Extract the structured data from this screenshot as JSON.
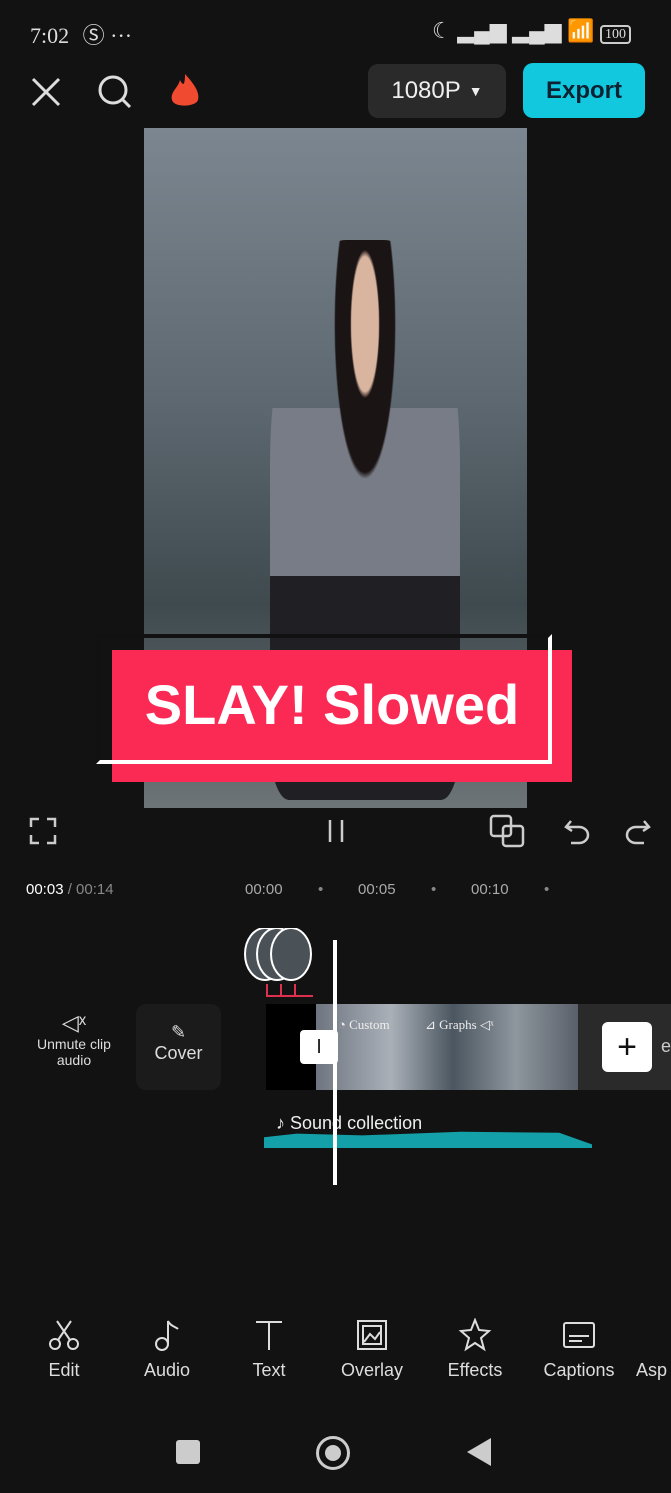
{
  "status": {
    "time": "7:02",
    "battery": "100"
  },
  "topbar": {
    "resolution": "1080P",
    "export": "Export"
  },
  "preview": {
    "sticker_text": "SLAY! Slowed"
  },
  "timeline": {
    "current": "00:03",
    "total": "/ 00:14",
    "ticks": [
      "00:00",
      "00:05",
      "00:10"
    ],
    "unmute": "Unmute clip audio",
    "cover": "Cover",
    "clip_labels": {
      "custom": "Custom",
      "graphs": "Graphs"
    },
    "audio_track": "Sound collection",
    "add_end_label": "e"
  },
  "toolbar": [
    {
      "label": "Edit",
      "icon": "scissors-icon"
    },
    {
      "label": "Audio",
      "icon": "music-note-icon"
    },
    {
      "label": "Text",
      "icon": "text-icon"
    },
    {
      "label": "Overlay",
      "icon": "overlay-icon"
    },
    {
      "label": "Effects",
      "icon": "effects-star-icon"
    },
    {
      "label": "Captions",
      "icon": "captions-icon"
    },
    {
      "label": "Asp",
      "icon": "aspect-icon"
    }
  ],
  "colors": {
    "accent": "#12c8de",
    "sticker": "#fb2a55",
    "waveform": "#14a0a8"
  }
}
